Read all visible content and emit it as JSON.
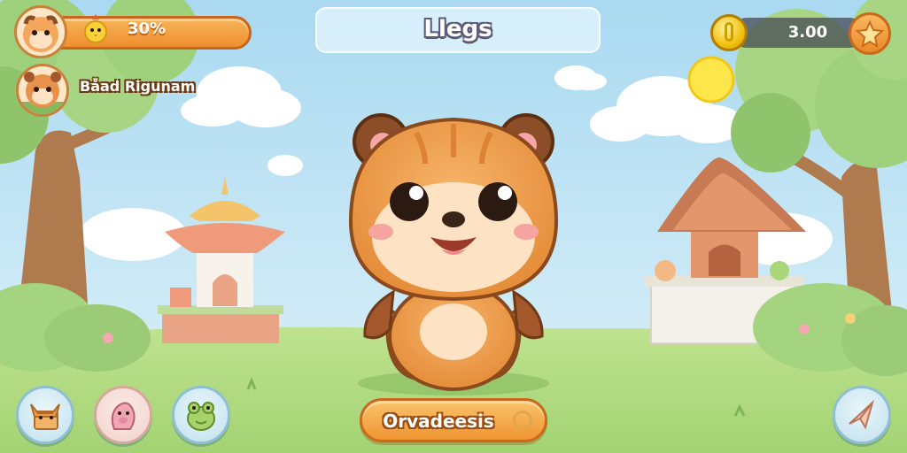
{
  "header": {
    "progress_label": "30%",
    "progress_fraction": 0.3,
    "player_name": "Båad Rigunam",
    "title": "Llegs"
  },
  "currency": {
    "coins": "3.00"
  },
  "footer": {
    "action_label": "Orvadeesis"
  },
  "icons": {
    "avatar_main": "squirrel-avatar-icon",
    "chick": "chick-icon",
    "avatar_secondary": "hamster-avatar-icon",
    "coin": "coin-icon",
    "star": "star-icon",
    "btn1": "fox-icon",
    "btn2": "pig-icon",
    "btn3": "frog-icon",
    "share": "paper-plane-icon",
    "swirl": "swirl-icon"
  },
  "colors": {
    "accent_orange": "#ef9432",
    "sky": "#bfe4f5",
    "grass": "#a9d67a"
  }
}
